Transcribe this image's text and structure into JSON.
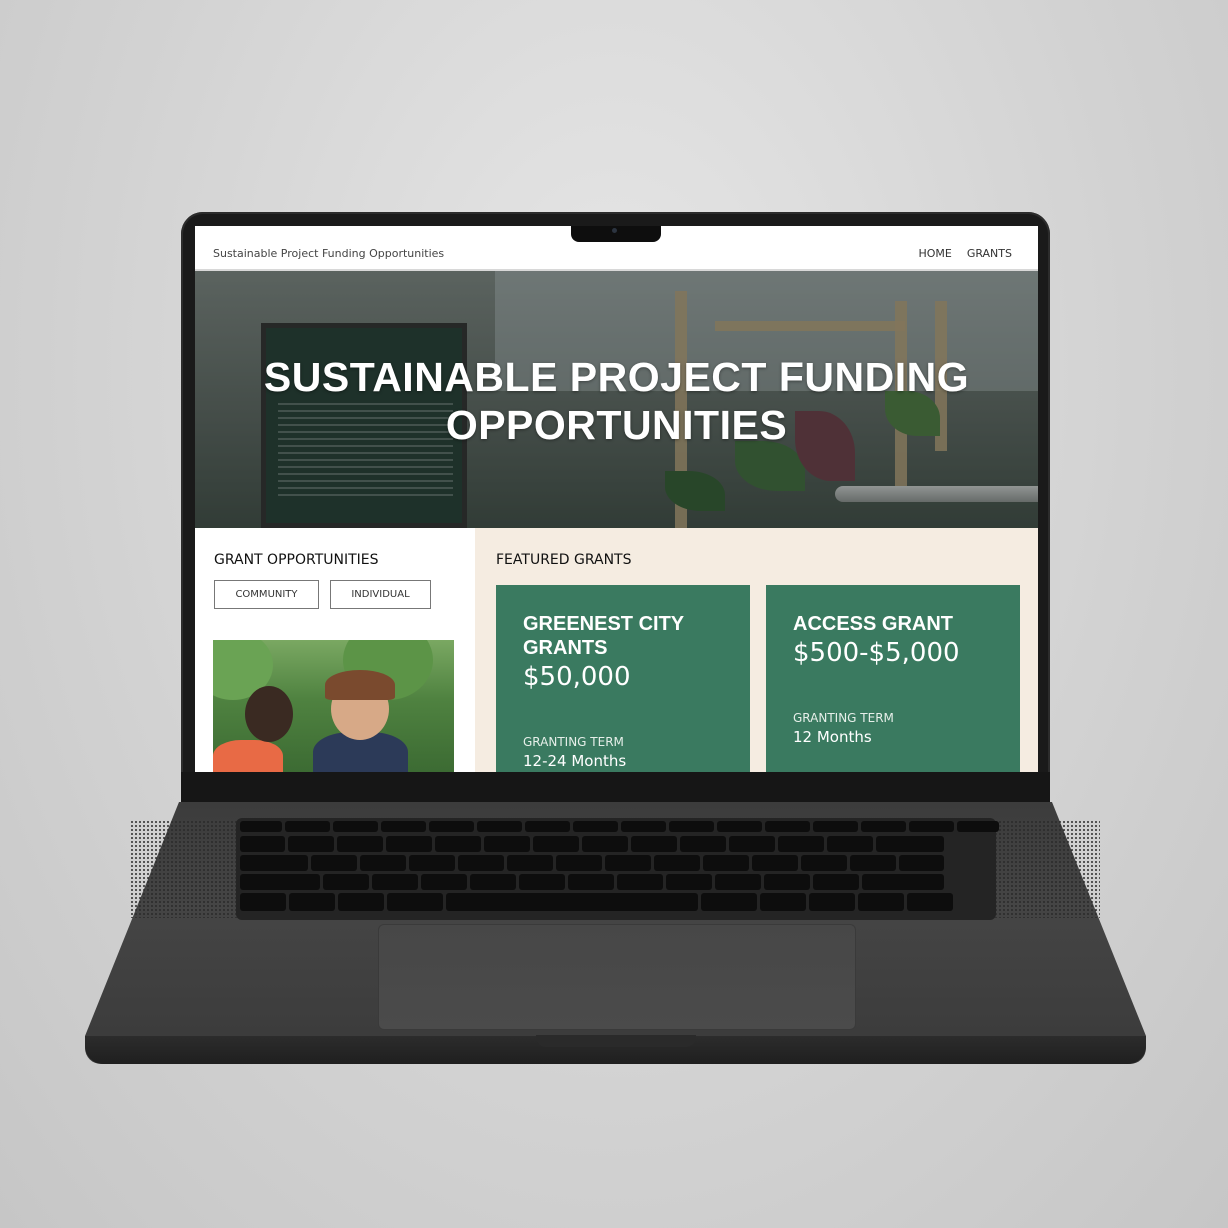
{
  "site": {
    "title": "Sustainable Project Funding Opportunities",
    "nav": [
      "HOME",
      "GRANTS"
    ]
  },
  "hero": {
    "line1": "SUSTAINABLE PROJECT FUNDING",
    "line2": "OPPORTUNITIES"
  },
  "grant_opportunities": {
    "heading": "GRANT OPPORTUNITIES",
    "filters": [
      "COMMUNITY",
      "INDIVIDUAL"
    ]
  },
  "featured": {
    "heading": "FEATURED GRANTS",
    "cards": [
      {
        "title_line1": "GREENEST CITY",
        "title_line2": "GRANTS",
        "amount": "$50,000",
        "term_label": "GRANTING TERM",
        "term_value": "12-24 Months"
      },
      {
        "title_line1": "ACCESS GRANT",
        "amount": "$500-$5,000",
        "term_label": "GRANTING TERM",
        "term_value": "12 Months"
      }
    ]
  },
  "colors": {
    "card_green": "#3a7a60",
    "featured_bg": "#f5ece1",
    "laptop": "#1a1a1a"
  }
}
